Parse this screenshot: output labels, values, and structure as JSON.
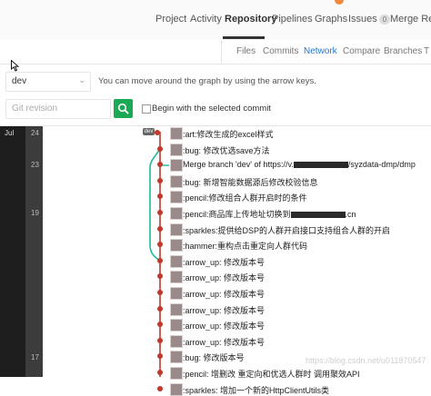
{
  "nav": {
    "items": [
      {
        "label": "Project"
      },
      {
        "label": "Activity"
      },
      {
        "label": "Repository"
      },
      {
        "label": "Pipelines"
      },
      {
        "label": "Graphs"
      },
      {
        "label": "Issues",
        "count": "0"
      },
      {
        "label": "Merge Requ"
      }
    ],
    "active": "Repository"
  },
  "subnav": {
    "items": [
      {
        "label": "Files"
      },
      {
        "label": "Commits"
      },
      {
        "label": "Network"
      },
      {
        "label": "Compare"
      },
      {
        "label": "Branches"
      },
      {
        "label": "T"
      }
    ],
    "active": "Network"
  },
  "ref_select": {
    "value": "dev"
  },
  "hint": "You can move around the graph by using the arrow keys.",
  "revision": {
    "placeholder": "Git revision"
  },
  "begin_checkbox": {
    "label": "Begin with the selected commit",
    "checked": false
  },
  "graph": {
    "month": "Jul",
    "days": [
      "24",
      "23",
      "19",
      "17"
    ],
    "branch_tag": "dev",
    "commits": [
      {
        "message": ":art:修改生成的excel样式"
      },
      {
        "message": ":bug: 修改优选save方法"
      },
      {
        "message": "Merge branch 'dev' of https://v.",
        "suffix": "/syzdata-dmp/dmp"
      },
      {
        "message": ":bug: 新增智能数据源后修改校验信息"
      },
      {
        "message": ":pencil:修改组合人群开启时的条件"
      },
      {
        "message": ":pencil:商品库上传地址切换到",
        "suffix": ".cn"
      },
      {
        "message": ":sparkles:提供给DSP的人群开启接口支持组合人群的开启"
      },
      {
        "message": ":hammer:重构点击重定向人群代码"
      },
      {
        "message": ":arrow_up: 修改版本号"
      },
      {
        "message": ":arrow_up: 修改版本号"
      },
      {
        "message": ":arrow_up: 修改版本号"
      },
      {
        "message": ":arrow_up: 修改版本号"
      },
      {
        "message": ":arrow_up: 修改版本号"
      },
      {
        "message": ":arrow_up: 修改版本号"
      },
      {
        "message": ":bug: 修改版本号"
      },
      {
        "message": ":pencil: 增删改 重定向和优选人群时 调用聚效API"
      },
      {
        "message": ":sparkles: 增加一个新的HttpClientUtils类"
      }
    ]
  },
  "watermark": "https://blog.csdn.net/u011870547",
  "colors": {
    "accent": "#1f78d1",
    "success": "#1aaa55",
    "branch_main": "#c0392b",
    "branch_side": "#1abc9c"
  }
}
